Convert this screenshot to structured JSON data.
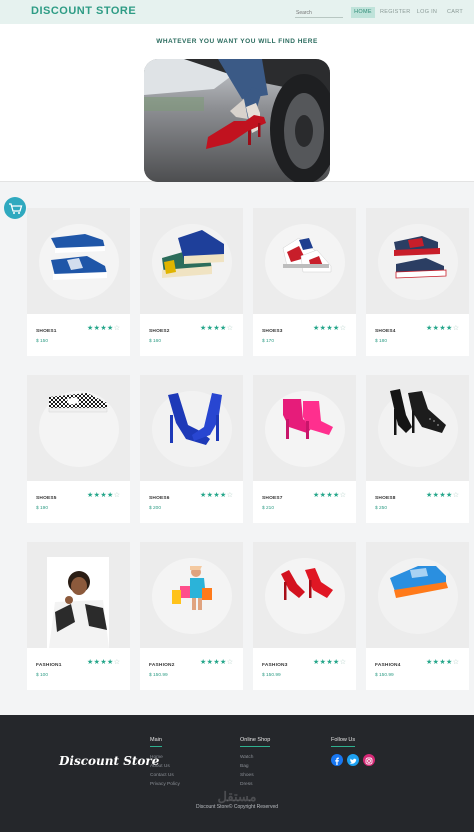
{
  "header": {
    "brand": "DISCOUNT STORE",
    "search_placeholder": "Search",
    "nav": [
      "HOME",
      "REGISTER",
      "LOG IN",
      "CART"
    ]
  },
  "hero": {
    "tagline": "WHATEVER YOU WANT YOU WILL FIND HERE"
  },
  "colors": {
    "accent": "#2e9c85",
    "cart_button": "#2fa9bf",
    "footer_bg": "#25272b"
  },
  "products": [
    {
      "name": "SHOES1",
      "price": "$ 150",
      "rating": 4
    },
    {
      "name": "SHOES2",
      "price": "$ 160",
      "rating": 4
    },
    {
      "name": "SHOES3",
      "price": "$ 170",
      "rating": 4
    },
    {
      "name": "SHOES4",
      "price": "$ 180",
      "rating": 4
    },
    {
      "name": "SHOES5",
      "price": "$ 190",
      "rating": 4
    },
    {
      "name": "SHOES6",
      "price": "$ 200",
      "rating": 4
    },
    {
      "name": "SHOES7",
      "price": "$ 210",
      "rating": 4
    },
    {
      "name": "SHOES8",
      "price": "$ 250",
      "rating": 4
    },
    {
      "name": "FASHION1",
      "price": "$ 100",
      "rating": 4
    },
    {
      "name": "FASHION2",
      "price": "$ 150.99",
      "rating": 4
    },
    {
      "name": "FASHION3",
      "price": "$ 150.99",
      "rating": 4
    },
    {
      "name": "FASHION4",
      "price": "$ 150.99",
      "rating": 4
    }
  ],
  "footer": {
    "logo": "Discount Store",
    "main": {
      "title": "Main",
      "links": [
        "Home",
        "About Us",
        "Contact Us",
        "Privacy Policy"
      ]
    },
    "shop": {
      "title": "Online Shop",
      "links": [
        "Watch",
        "Bag",
        "Shoes",
        "Dress"
      ]
    },
    "follow": {
      "title": "Follow Us"
    },
    "copyright": "Discount Store© Copyright Reserved"
  }
}
